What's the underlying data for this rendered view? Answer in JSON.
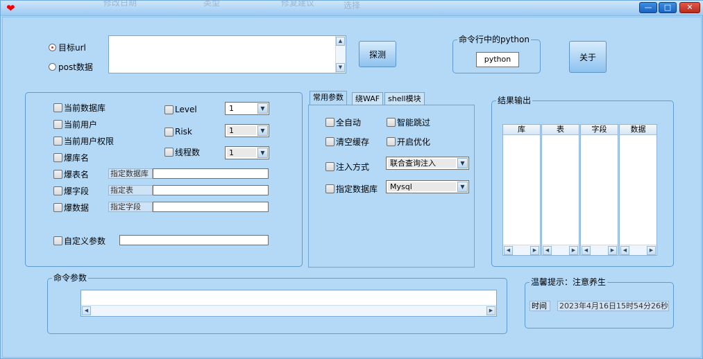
{
  "titlebar": {
    "ghost_texts": [
      "修改日期",
      "类型",
      "修复建议",
      "选择"
    ],
    "min_label": "—",
    "max_label": "□",
    "close_label": "✕"
  },
  "target": {
    "radio_url_label": "目标url",
    "radio_post_label": "post数据",
    "selected": "目标url",
    "url_value": ""
  },
  "buttons": {
    "probe_label": "探测",
    "about_label": "关于"
  },
  "python_group": {
    "title": "命令行中的python",
    "value": "python"
  },
  "options": {
    "checkboxes": [
      "当前数据库",
      "当前用户",
      "当前用户权限",
      "爆库名",
      "爆表名",
      "爆字段",
      "爆数据"
    ],
    "custom_param_label": "自定义参数",
    "custom_param_value": "",
    "spec_db_label": "指定数据库",
    "spec_table_label": "指定表",
    "spec_field_label": "指定字段",
    "level_label": "Level",
    "level_value": "1",
    "risk_label": "Risk",
    "risk_value": "1",
    "threads_label": "线程数",
    "threads_value": "1"
  },
  "tabs": [
    {
      "label": "常用参数",
      "active": true
    },
    {
      "label": "绕WAF",
      "active": false
    },
    {
      "label": "shell模块",
      "active": false
    }
  ],
  "common": {
    "auto_label": "全自动",
    "smart_skip_label": "智能跳过",
    "clear_cache_label": "清空缓存",
    "optimize_label": "开启优化",
    "inject_label": "注入方式",
    "inject_value": "联合查询注入",
    "db_label": "指定数据库",
    "db_value": "Mysql"
  },
  "results": {
    "title": "结果输出",
    "columns": [
      "库",
      "表",
      "字段",
      "数据"
    ]
  },
  "command": {
    "title": "命令参数",
    "value": ""
  },
  "tips": {
    "title": "温馨提示：注意养生",
    "time_label": "时间",
    "time_value": "2023年4月16日15时54分26秒"
  }
}
